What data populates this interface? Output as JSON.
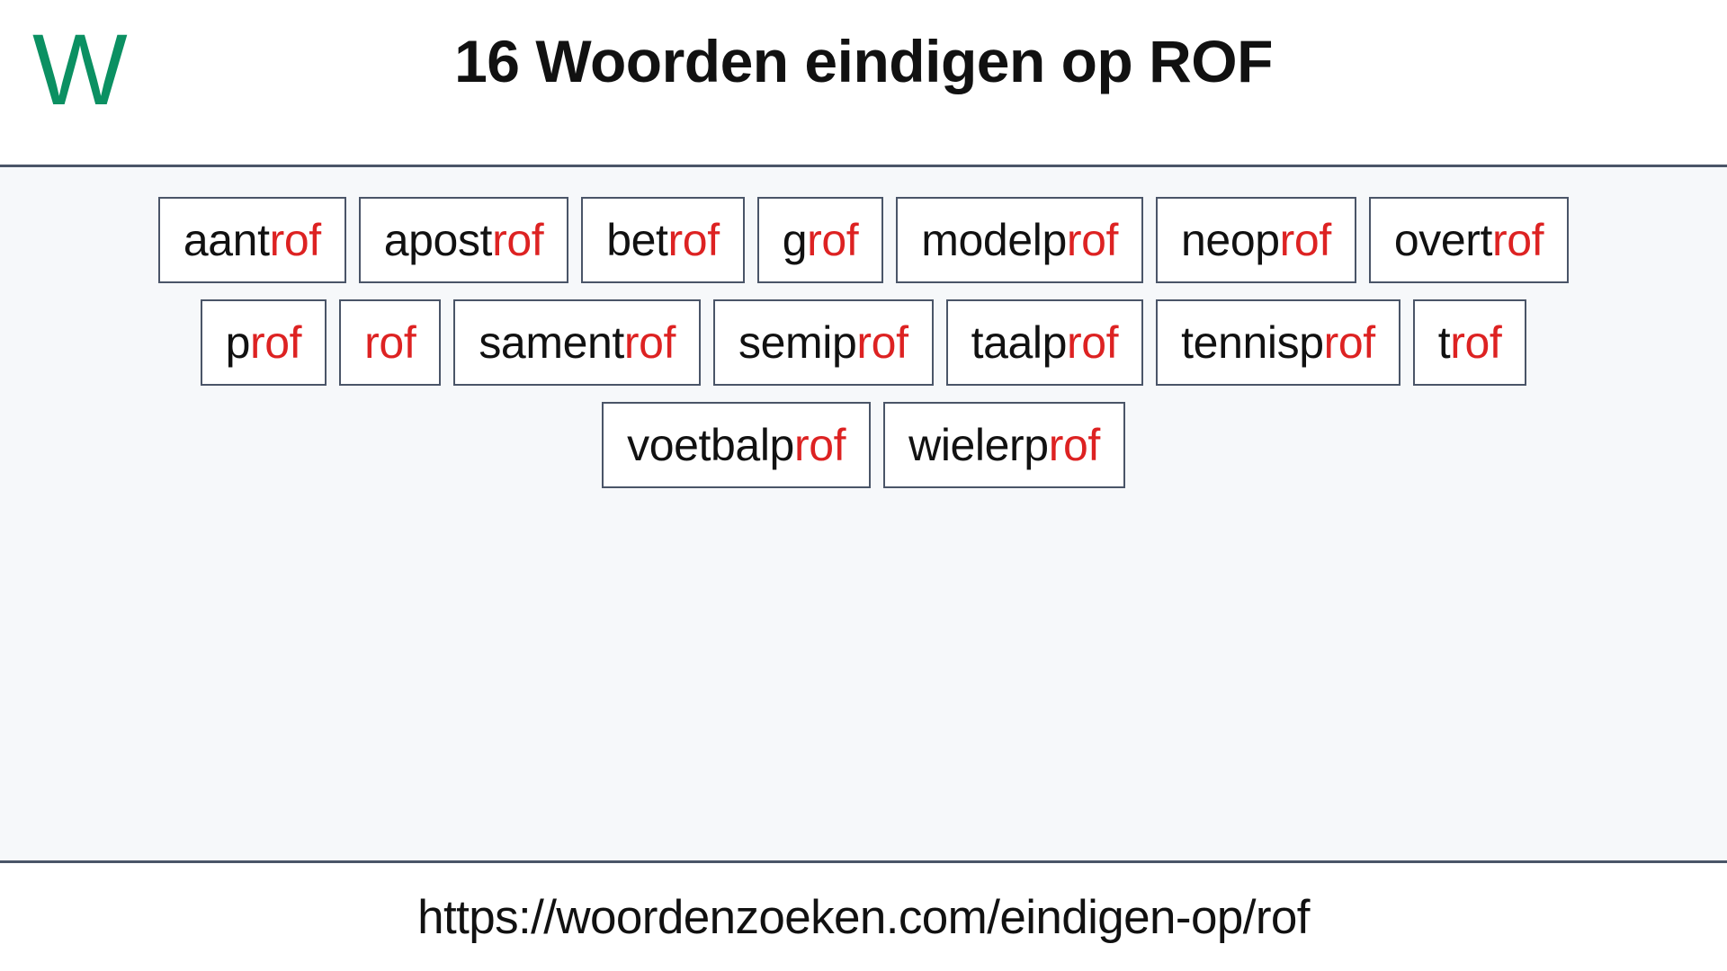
{
  "header": {
    "logo_text": "W",
    "logo_color": "#0b9062",
    "title": "16 Woorden eindigen op ROF"
  },
  "theme": {
    "suffix_color": "#dd2222",
    "border_color": "#4a5568",
    "main_background": "#f6f8fa",
    "text_color": "#111111"
  },
  "main": {
    "suffix": "rof",
    "rows": [
      [
        {
          "full": "aantrof",
          "prefix": "aant",
          "suffix": "rof"
        },
        {
          "full": "apostrof",
          "prefix": "apost",
          "suffix": "rof"
        },
        {
          "full": "betrof",
          "prefix": "bet",
          "suffix": "rof"
        },
        {
          "full": "grof",
          "prefix": "g",
          "suffix": "rof"
        },
        {
          "full": "modelprof",
          "prefix": "modelp",
          "suffix": "rof"
        },
        {
          "full": "neoprof",
          "prefix": "neop",
          "suffix": "rof"
        },
        {
          "full": "overtrof",
          "prefix": "overt",
          "suffix": "rof"
        }
      ],
      [
        {
          "full": "prof",
          "prefix": "p",
          "suffix": "rof"
        },
        {
          "full": "rof",
          "prefix": "",
          "suffix": "rof"
        },
        {
          "full": "samentrof",
          "prefix": "sament",
          "suffix": "rof"
        },
        {
          "full": "semiprof",
          "prefix": "semip",
          "suffix": "rof"
        },
        {
          "full": "taalprof",
          "prefix": "taalp",
          "suffix": "rof"
        },
        {
          "full": "tennisprof",
          "prefix": "tennisp",
          "suffix": "rof"
        },
        {
          "full": "trof",
          "prefix": "t",
          "suffix": "rof"
        }
      ],
      [
        {
          "full": "voetbalprof",
          "prefix": "voetbalp",
          "suffix": "rof"
        },
        {
          "full": "wielerprof",
          "prefix": "wielerp",
          "suffix": "rof"
        }
      ]
    ]
  },
  "footer": {
    "url": "https://woordenzoeken.com/eindigen-op/rof"
  }
}
